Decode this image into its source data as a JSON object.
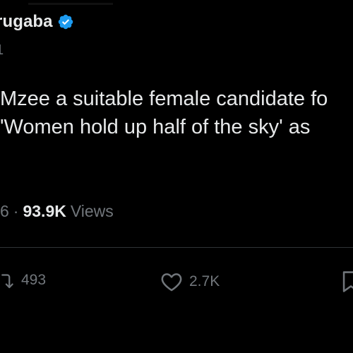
{
  "tweet": {
    "author_name": "rugaba",
    "handle_partial": "1",
    "text_lines": [
      "Mzee a suitable female candidate fo",
      "'Women hold up half of the sky' as"
    ],
    "time_partial": "6",
    "separator": "·",
    "views_count": "93.9K",
    "views_label": "Views"
  },
  "actions": {
    "retweet_count": "493",
    "like_count": "2.7K"
  },
  "colors": {
    "background": "#000000",
    "text": "#e7e9ea",
    "muted": "#71767b",
    "verified_blue": "#1d9bf0",
    "divider": "#2f3336"
  },
  "icons": {
    "verified": "verified-badge-icon",
    "retweet": "retweet-icon",
    "like": "heart-icon",
    "bookmark": "bookmark-icon"
  }
}
